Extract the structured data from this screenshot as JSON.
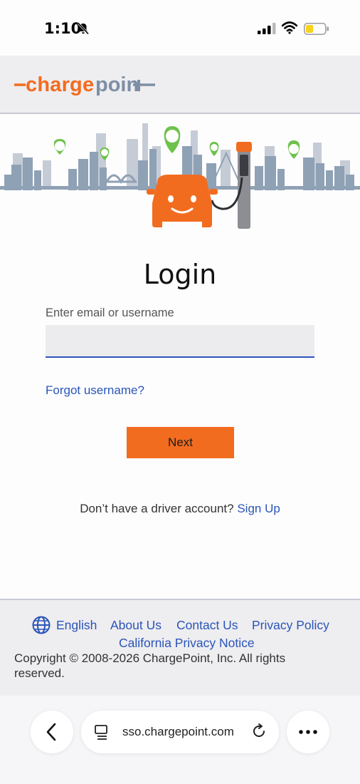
{
  "status_bar": {
    "time": "1:10"
  },
  "login": {
    "title": "Login",
    "email_label": "Enter email or username",
    "email_value": "",
    "forgot_link": "Forgot username?",
    "next_label": "Next",
    "signup_prompt": "Don’t have a driver account?",
    "signup_link": "Sign Up"
  },
  "footer": {
    "language": "English",
    "links": [
      "About Us",
      "Contact Us",
      "Privacy Policy",
      "California Privacy Notice"
    ],
    "copyright": "Copyright © 2008-2026 ChargePoint, Inc. All rights reserved."
  },
  "browser": {
    "url": "sso.chargepoint.com"
  },
  "colors": {
    "brand_orange": "#f26c1f",
    "link_blue": "#2a55b8",
    "brand_gray": "#7d8fa6",
    "pin_green": "#6dc24b"
  },
  "icons": [
    "bell-off-icon",
    "signal-icon",
    "wifi-icon",
    "battery-icon",
    "globe-icon",
    "back-icon",
    "tab-icon",
    "reload-icon",
    "more-icon"
  ]
}
